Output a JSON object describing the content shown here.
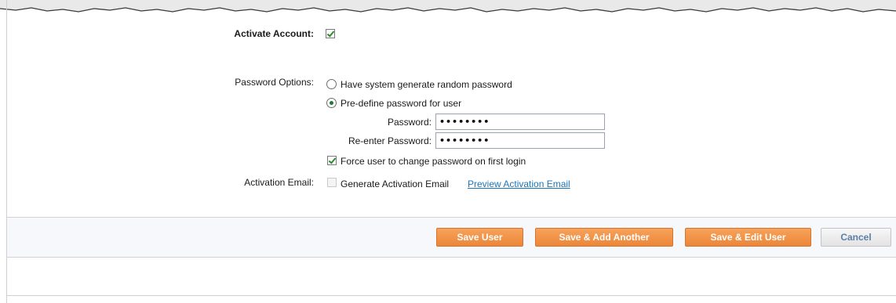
{
  "account": {
    "activate_label": "Activate Account:",
    "activate_checked": true
  },
  "password_options": {
    "label": "Password Options:",
    "radio_generate_label": "Have system generate random password",
    "radio_predefine_label": "Pre-define password for user",
    "selected": "predefine",
    "password_label": "Password:",
    "password_value": "••••••••",
    "reenter_label": "Re-enter Password:",
    "reenter_value": "••••••••",
    "force_change_label": "Force user to change password on first login",
    "force_change_checked": true
  },
  "activation_email": {
    "label": "Activation Email:",
    "generate_label": "Generate Activation Email",
    "generate_checked": false,
    "preview_link": "Preview Activation Email"
  },
  "buttons": {
    "save_user": "Save User",
    "save_add_another": "Save & Add Another",
    "save_edit_user": "Save & Edit User",
    "cancel": "Cancel"
  },
  "colors": {
    "button_orange": "#ec8639",
    "link_blue": "#1b75bb",
    "check_green": "#2e8b2e"
  }
}
